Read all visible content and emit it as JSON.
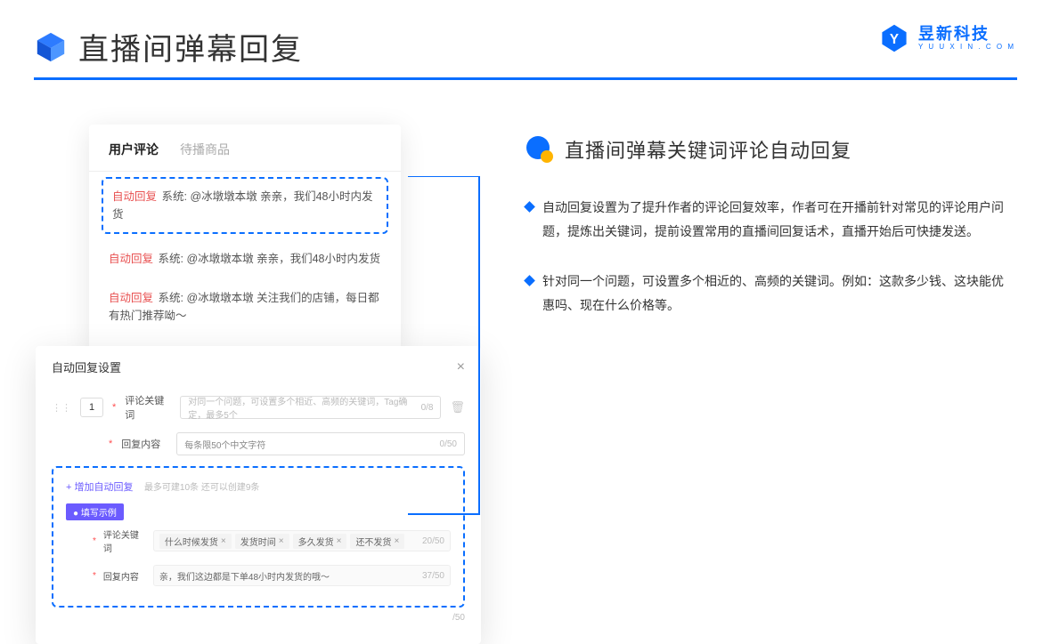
{
  "header": {
    "title": "直播间弹幕回复",
    "brand_cn": "昱新科技",
    "brand_en": "Y U U X I N . C O M"
  },
  "left": {
    "tabs": {
      "active": "用户评论",
      "inactive": "待播商品"
    },
    "comments": [
      {
        "badge": "自动回复",
        "text": "系统: @冰墩墩本墩 亲亲，我们48小时内发货"
      },
      {
        "badge": "自动回复",
        "text": "系统: @冰墩墩本墩 亲亲，我们48小时内发货"
      },
      {
        "badge": "自动回复",
        "text": "系统: @冰墩墩本墩 关注我们的店铺，每日都有热门推荐呦～"
      }
    ],
    "settings_title": "自动回复设置",
    "row_num": "1",
    "kw_label": "评论关键词",
    "kw_placeholder": "对同一个问题，可设置多个相近、高频的关键词，Tag确定，最多5个",
    "kw_count": "0/8",
    "reply_label": "回复内容",
    "reply_placeholder": "每条限50个中文字符",
    "reply_count": "0/50",
    "add_link": "+ 增加自动回复",
    "add_note": "最多可建10条 还可以创建9条",
    "example_badge": "● 填写示例",
    "ex_kw_label": "评论关键词",
    "ex_tags": [
      "什么时候发货",
      "发货时间",
      "多久发货",
      "还不发货"
    ],
    "ex_kw_count": "20/50",
    "ex_reply_label": "回复内容",
    "ex_reply_text": "亲，我们这边都是下单48小时内发货的哦～",
    "ex_reply_count": "37/50",
    "outer_count": "/50"
  },
  "right": {
    "section_title": "直播间弹幕关键词评论自动回复",
    "bullets": [
      "自动回复设置为了提升作者的评论回复效率，作者可在开播前针对常见的评论用户问题，提炼出关键词，提前设置常用的直播间回复话术，直播开始后可快捷发送。",
      "针对同一个问题，可设置多个相近的、高频的关键词。例如：这款多少钱、这块能优惠吗、现在什么价格等。"
    ]
  }
}
